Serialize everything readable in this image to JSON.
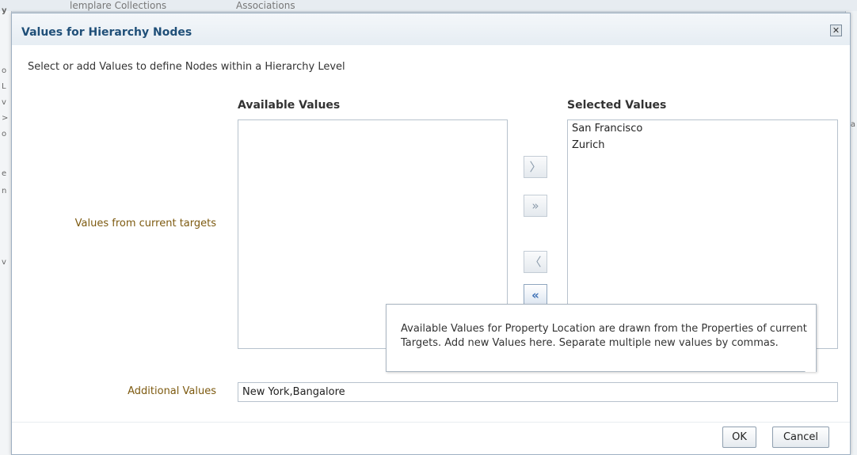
{
  "background": {
    "tabs": [
      "lemplare Collections",
      "Associations"
    ],
    "left_chars": [
      "y",
      "o",
      "L",
      "v",
      ">",
      "o",
      "e",
      "n",
      "v"
    ],
    "right_chars": [
      "a"
    ]
  },
  "dialog": {
    "title": "Values for Hierarchy Nodes",
    "close_icon": "close-icon",
    "instruction": "Select or add Values to define Nodes within a Hierarchy Level",
    "row_label": "Values from current targets",
    "available": {
      "heading": "Available Values",
      "items": []
    },
    "selected": {
      "heading": "Selected Values",
      "items": [
        "San Francisco",
        "Zurich"
      ]
    },
    "shuttle": {
      "move": "〉",
      "move_all": "»",
      "remove": "〈",
      "remove_all": "«"
    },
    "additional": {
      "label": "Additional Values",
      "value": "New York,Bangalore"
    },
    "note": "Available Values for Property Location are drawn from the Properties of current Targets. Add new Values here. Separate multiple new values by commas.",
    "buttons": {
      "ok": "OK",
      "cancel": "Cancel"
    }
  }
}
